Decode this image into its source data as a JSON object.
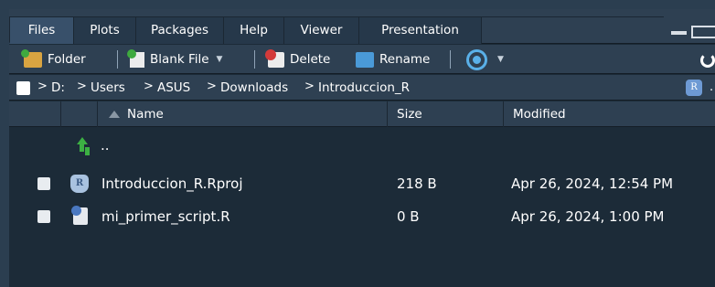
{
  "tabs": [
    {
      "label": "Files",
      "active": true
    },
    {
      "label": "Plots",
      "active": false
    },
    {
      "label": "Packages",
      "active": false
    },
    {
      "label": "Help",
      "active": false
    },
    {
      "label": "Viewer",
      "active": false
    },
    {
      "label": "Presentation",
      "active": false
    }
  ],
  "toolbar": {
    "new_folder": "Folder",
    "blank_file": "Blank File",
    "delete": "Delete",
    "rename": "Rename",
    "icons": [
      "new-folder-icon",
      "new-blank-file-icon",
      "delete-icon",
      "rename-icon",
      "gear-icon",
      "refresh-icon"
    ]
  },
  "breadcrumb": [
    "D:",
    "Users",
    "ASUS",
    "Downloads",
    "Introduccion_R"
  ],
  "breadcrumb_badge": "R",
  "breadcrumb_more": ".",
  "columns": {
    "name": "Name",
    "size": "Size",
    "modified": "Modified"
  },
  "parent_dir": "..",
  "files": [
    {
      "name": "Introduccion_R.Rproj",
      "size": "218 B",
      "modified": "Apr 26, 2024, 12:54 PM",
      "icon": "rproj-icon"
    },
    {
      "name": "mi_primer_script.R",
      "size": "0 B",
      "modified": "Apr 26, 2024, 1:00 PM",
      "icon": "r-script-icon"
    }
  ],
  "colors": {
    "background": "#2b3e50",
    "panel": "#1c2b38",
    "toolbar": "#2e4052",
    "active_tab": "#38506a",
    "accent_green": "#3cb043"
  }
}
